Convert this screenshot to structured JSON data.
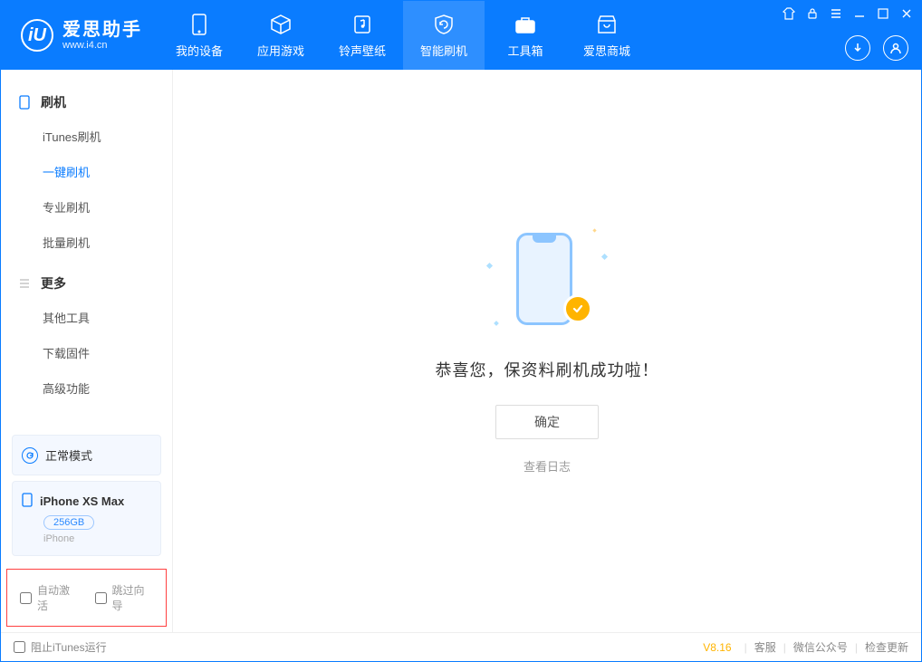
{
  "app": {
    "title": "爱思助手",
    "subtitle": "www.i4.cn"
  },
  "nav": {
    "tabs": [
      {
        "label": "我的设备"
      },
      {
        "label": "应用游戏"
      },
      {
        "label": "铃声壁纸"
      },
      {
        "label": "智能刷机"
      },
      {
        "label": "工具箱"
      },
      {
        "label": "爱思商城"
      }
    ]
  },
  "sidebar": {
    "group1": {
      "title": "刷机",
      "items": [
        "iTunes刷机",
        "一键刷机",
        "专业刷机",
        "批量刷机"
      ]
    },
    "group2": {
      "title": "更多",
      "items": [
        "其他工具",
        "下载固件",
        "高级功能"
      ]
    },
    "mode": {
      "label": "正常模式"
    },
    "device": {
      "name": "iPhone XS Max",
      "capacity": "256GB",
      "type": "iPhone"
    },
    "checks": {
      "auto_activate": "自动激活",
      "skip_guide": "跳过向导"
    }
  },
  "main": {
    "success_message": "恭喜您，保资料刷机成功啦！",
    "ok_button": "确定",
    "view_log": "查看日志"
  },
  "footer": {
    "block_itunes": "阻止iTunes运行",
    "version": "V8.16",
    "links": [
      "客服",
      "微信公众号",
      "检查更新"
    ]
  }
}
